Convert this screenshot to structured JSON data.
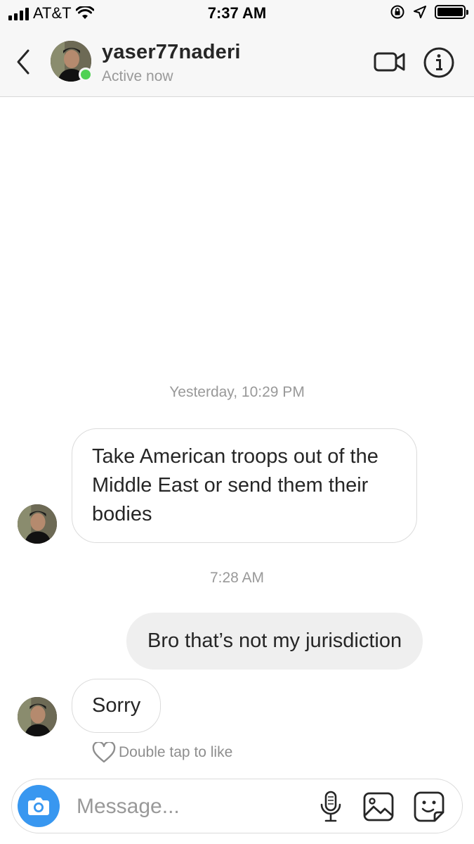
{
  "status_bar": {
    "carrier": "AT&T",
    "time": "7:37 AM",
    "icons": [
      "signal-icon",
      "wifi-icon",
      "orientation-lock-icon",
      "location-icon",
      "battery-icon"
    ]
  },
  "header": {
    "username": "yaser77naderi",
    "status": "Active now",
    "icons": [
      "back-chevron-icon",
      "video-call-icon",
      "info-icon"
    ],
    "online_color": "#4fd153"
  },
  "thread": {
    "timestamps": [
      "Yesterday, 10:29 PM",
      "7:28 AM"
    ],
    "messages": [
      {
        "sender": "them",
        "text": "Take American troops out of the Middle East or send them their bodies"
      },
      {
        "sender": "me",
        "text": "Bro that’s not my jurisdiction"
      },
      {
        "sender": "them",
        "text": "Sorry"
      }
    ],
    "like_hint": "Double tap to like"
  },
  "composer": {
    "placeholder": "Message...",
    "value": "",
    "accent_color": "#3897f0",
    "icons": [
      "camera-icon",
      "microphone-icon",
      "gallery-icon",
      "sticker-icon"
    ]
  }
}
